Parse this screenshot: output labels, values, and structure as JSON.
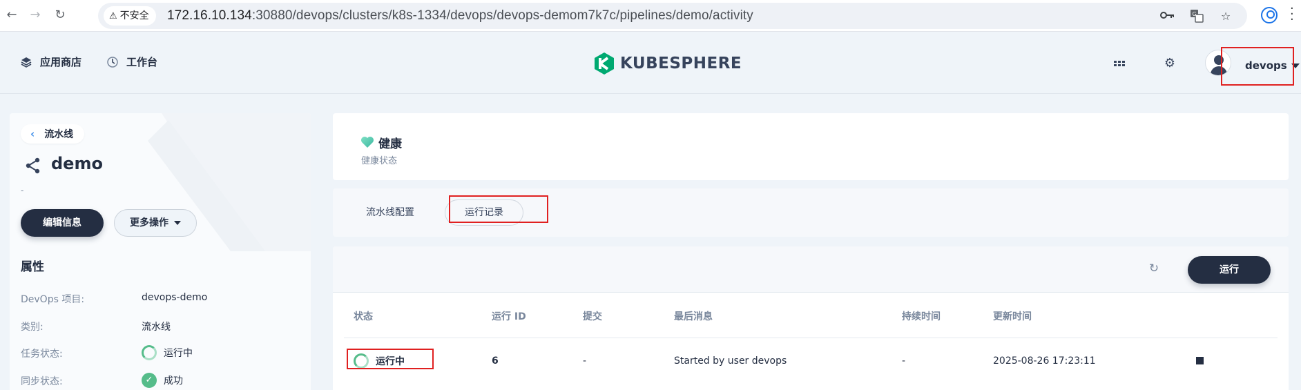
{
  "browser": {
    "security_label": "不安全",
    "url_host": "172.16.10.134",
    "url_path": ":30880/devops/clusters/k8s-1334/devops/devops-demom7k7c/pipelines/demo/activity",
    "icons": [
      "back-arrow-icon",
      "forward-arrow-icon",
      "reload-icon",
      "password-key-icon",
      "translate-icon",
      "bookmark-star-icon",
      "profile-icon",
      "menu-kebab-icon"
    ]
  },
  "header": {
    "app_store_label": "应用商店",
    "workbench_label": "工作台",
    "logo_text": "KUBESPHERE",
    "user_name": "devops",
    "icons": [
      "grid-apps-icon",
      "gear-icon",
      "avatar"
    ]
  },
  "sidebar": {
    "back_label": "流水线",
    "pipeline_name": "demo",
    "description": "-",
    "edit_button": "编辑信息",
    "more_button": "更多操作",
    "attributes_heading": "属性",
    "attributes": [
      {
        "key": "DevOps 项目:",
        "value": "devops-demo"
      },
      {
        "key": "类别:",
        "value": "流水线"
      },
      {
        "key": "任务状态:",
        "value": "运行中"
      },
      {
        "key": "同步状态:",
        "value": "成功"
      }
    ]
  },
  "health": {
    "title": "健康",
    "subtitle": "健康状态"
  },
  "tabs": [
    {
      "label": "流水线配置",
      "active": false
    },
    {
      "label": "运行记录",
      "active": true
    }
  ],
  "runs": {
    "run_button": "运行",
    "columns": [
      "状态",
      "运行 ID",
      "提交",
      "最后消息",
      "持续时间",
      "更新时间"
    ],
    "rows": [
      {
        "status": "运行中",
        "run_id": "6",
        "commit": "-",
        "last_message": "Started by user devops",
        "duration": "-",
        "updated": "2025-08-26 17:23:11"
      }
    ]
  },
  "colors": {
    "primary_dark": "#242e42",
    "success_green": "#55bc8a",
    "highlight_red": "#e02020",
    "logo_green": "#00a971"
  }
}
